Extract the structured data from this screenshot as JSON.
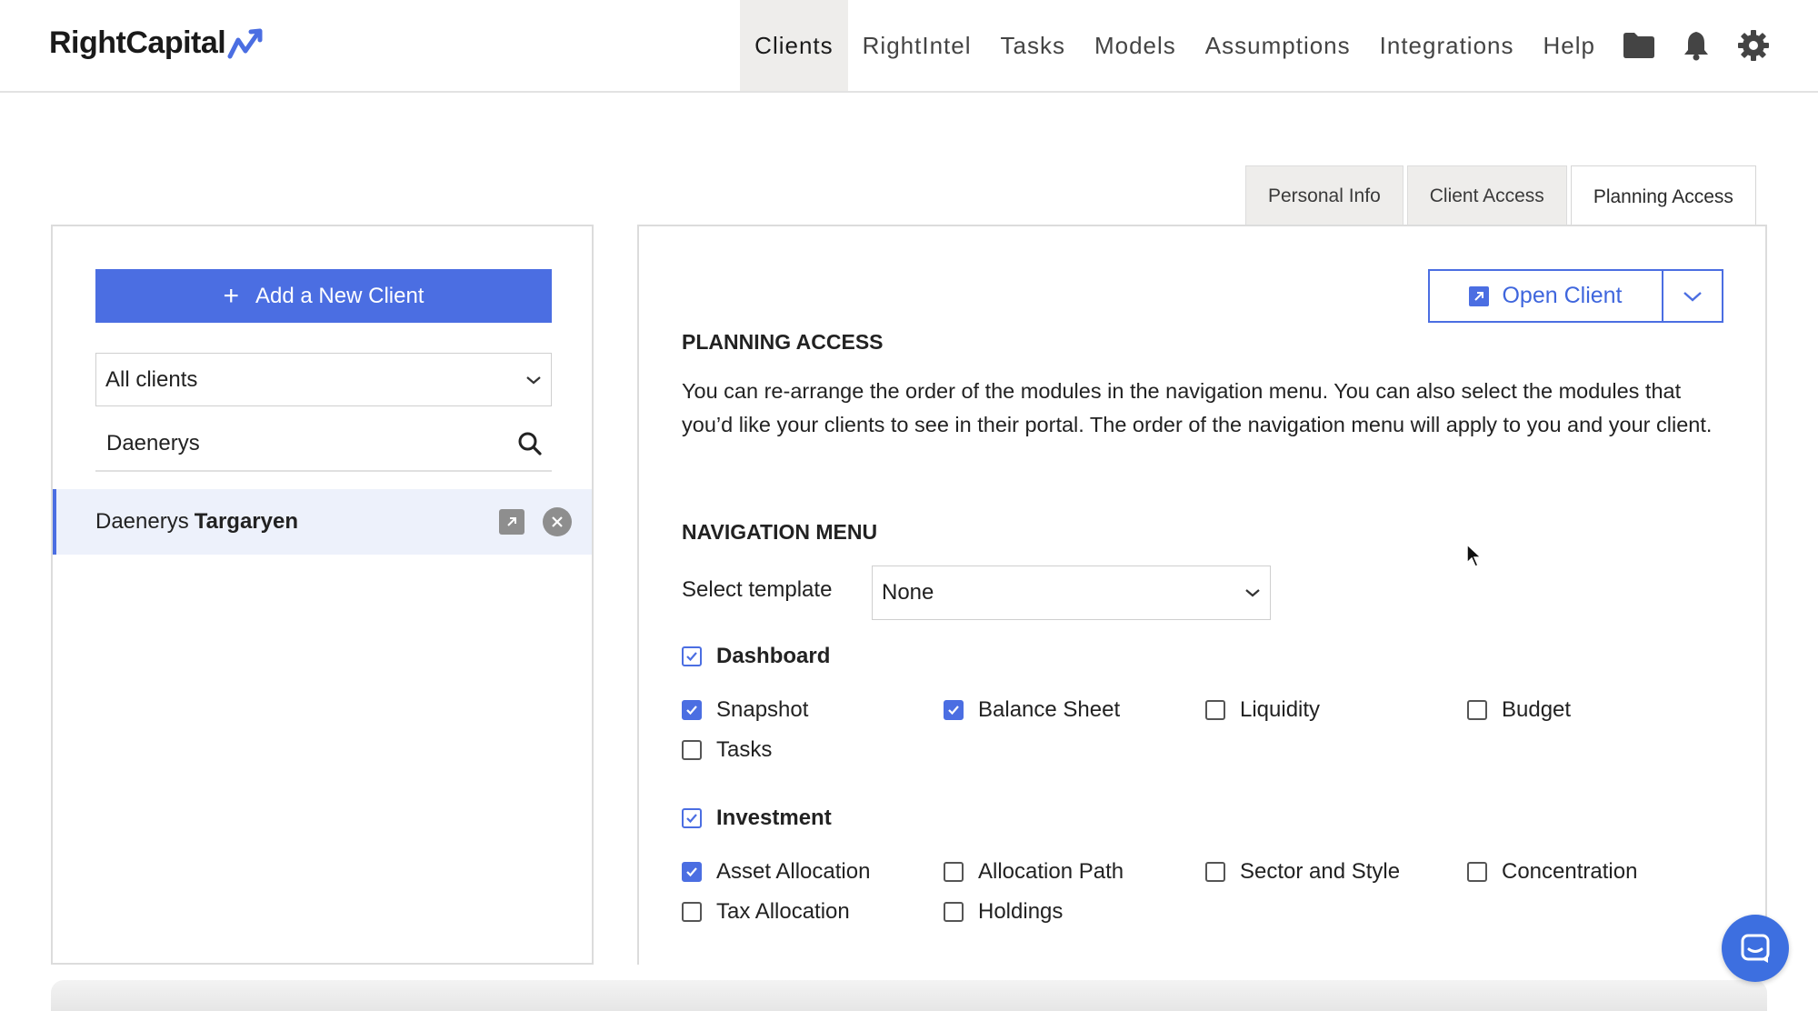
{
  "brand": {
    "name": "RightCapital"
  },
  "nav": {
    "items": [
      {
        "label": "Clients",
        "active": true
      },
      {
        "label": "RightIntel"
      },
      {
        "label": "Tasks"
      },
      {
        "label": "Models"
      },
      {
        "label": "Assumptions"
      },
      {
        "label": "Integrations"
      },
      {
        "label": "Help"
      }
    ],
    "icons": [
      "folder-icon",
      "bell-icon",
      "gear-icon"
    ]
  },
  "tabs": [
    {
      "label": "Personal Info"
    },
    {
      "label": "Client Access"
    },
    {
      "label": "Planning Access",
      "active": true
    }
  ],
  "sidebar": {
    "add_button": "Add a New Client",
    "filter": {
      "value": "All clients"
    },
    "search": {
      "value": "Daenerys"
    },
    "clients": [
      {
        "first": "Daenerys",
        "last": "Targaryen",
        "selected": true
      }
    ]
  },
  "main": {
    "open_client_label": "Open Client",
    "planning_title": "PLANNING ACCESS",
    "description": "You can re-arrange the order of the modules in the navigation menu. You can also select the modules that you’d like your clients to see in their portal. The order of the navigation menu will apply to you and your client.",
    "nav_menu_title": "NAVIGATION MENU",
    "template_label": "Select template",
    "template_value": "None",
    "groups": [
      {
        "label": "Dashboard",
        "checked": true,
        "items": [
          {
            "label": "Snapshot",
            "checked": true
          },
          {
            "label": "Balance Sheet",
            "checked": true
          },
          {
            "label": "Liquidity",
            "checked": false
          },
          {
            "label": "Budget",
            "checked": false
          },
          {
            "label": "Tasks",
            "checked": false
          }
        ]
      },
      {
        "label": "Investment",
        "checked": true,
        "items": [
          {
            "label": "Asset Allocation",
            "checked": true
          },
          {
            "label": "Allocation Path",
            "checked": false
          },
          {
            "label": "Sector and Style",
            "checked": false
          },
          {
            "label": "Concentration",
            "checked": false
          },
          {
            "label": "Tax Allocation",
            "checked": false
          },
          {
            "label": "Holdings",
            "checked": false
          }
        ]
      }
    ]
  },
  "colors": {
    "accent": "#4b6ee2",
    "chat": "#3d6fe0"
  }
}
